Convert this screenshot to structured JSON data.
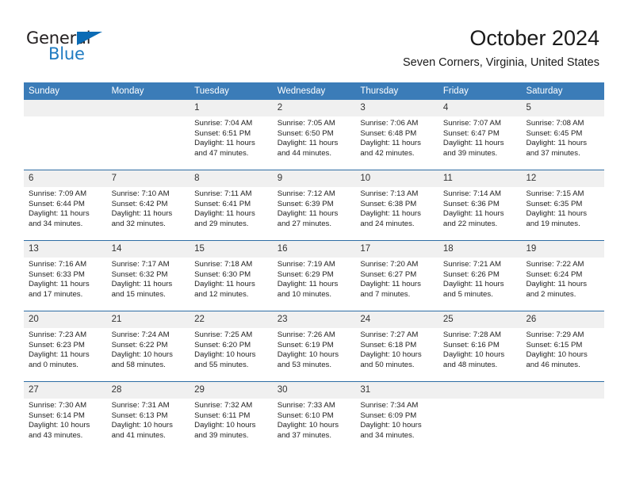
{
  "brand": {
    "name_part1": "General",
    "name_part2": "Blue",
    "accent_color": "#1f7bc1",
    "triangle_color": "#0b6bb5"
  },
  "header": {
    "title": "October 2024",
    "subtitle": "Seven Corners, Virginia, United States"
  },
  "theme": {
    "header_blue": "#3b7cb8",
    "row_separator": "#2e6da4",
    "day_band": "#f0f0f0"
  },
  "weekdays": [
    "Sunday",
    "Monday",
    "Tuesday",
    "Wednesday",
    "Thursday",
    "Friday",
    "Saturday"
  ],
  "labels": {
    "sunrise_prefix": "Sunrise:",
    "sunset_prefix": "Sunset:",
    "daylight_prefix": "Daylight:"
  },
  "weeks": [
    [
      {
        "day": "",
        "empty": true
      },
      {
        "day": "",
        "empty": true
      },
      {
        "day": "1",
        "sunrise": "Sunrise: 7:04 AM",
        "sunset": "Sunset: 6:51 PM",
        "daylight_line1": "Daylight: 11 hours",
        "daylight_line2": "and 47 minutes."
      },
      {
        "day": "2",
        "sunrise": "Sunrise: 7:05 AM",
        "sunset": "Sunset: 6:50 PM",
        "daylight_line1": "Daylight: 11 hours",
        "daylight_line2": "and 44 minutes."
      },
      {
        "day": "3",
        "sunrise": "Sunrise: 7:06 AM",
        "sunset": "Sunset: 6:48 PM",
        "daylight_line1": "Daylight: 11 hours",
        "daylight_line2": "and 42 minutes."
      },
      {
        "day": "4",
        "sunrise": "Sunrise: 7:07 AM",
        "sunset": "Sunset: 6:47 PM",
        "daylight_line1": "Daylight: 11 hours",
        "daylight_line2": "and 39 minutes."
      },
      {
        "day": "5",
        "sunrise": "Sunrise: 7:08 AM",
        "sunset": "Sunset: 6:45 PM",
        "daylight_line1": "Daylight: 11 hours",
        "daylight_line2": "and 37 minutes."
      }
    ],
    [
      {
        "day": "6",
        "sunrise": "Sunrise: 7:09 AM",
        "sunset": "Sunset: 6:44 PM",
        "daylight_line1": "Daylight: 11 hours",
        "daylight_line2": "and 34 minutes."
      },
      {
        "day": "7",
        "sunrise": "Sunrise: 7:10 AM",
        "sunset": "Sunset: 6:42 PM",
        "daylight_line1": "Daylight: 11 hours",
        "daylight_line2": "and 32 minutes."
      },
      {
        "day": "8",
        "sunrise": "Sunrise: 7:11 AM",
        "sunset": "Sunset: 6:41 PM",
        "daylight_line1": "Daylight: 11 hours",
        "daylight_line2": "and 29 minutes."
      },
      {
        "day": "9",
        "sunrise": "Sunrise: 7:12 AM",
        "sunset": "Sunset: 6:39 PM",
        "daylight_line1": "Daylight: 11 hours",
        "daylight_line2": "and 27 minutes."
      },
      {
        "day": "10",
        "sunrise": "Sunrise: 7:13 AM",
        "sunset": "Sunset: 6:38 PM",
        "daylight_line1": "Daylight: 11 hours",
        "daylight_line2": "and 24 minutes."
      },
      {
        "day": "11",
        "sunrise": "Sunrise: 7:14 AM",
        "sunset": "Sunset: 6:36 PM",
        "daylight_line1": "Daylight: 11 hours",
        "daylight_line2": "and 22 minutes."
      },
      {
        "day": "12",
        "sunrise": "Sunrise: 7:15 AM",
        "sunset": "Sunset: 6:35 PM",
        "daylight_line1": "Daylight: 11 hours",
        "daylight_line2": "and 19 minutes."
      }
    ],
    [
      {
        "day": "13",
        "sunrise": "Sunrise: 7:16 AM",
        "sunset": "Sunset: 6:33 PM",
        "daylight_line1": "Daylight: 11 hours",
        "daylight_line2": "and 17 minutes."
      },
      {
        "day": "14",
        "sunrise": "Sunrise: 7:17 AM",
        "sunset": "Sunset: 6:32 PM",
        "daylight_line1": "Daylight: 11 hours",
        "daylight_line2": "and 15 minutes."
      },
      {
        "day": "15",
        "sunrise": "Sunrise: 7:18 AM",
        "sunset": "Sunset: 6:30 PM",
        "daylight_line1": "Daylight: 11 hours",
        "daylight_line2": "and 12 minutes."
      },
      {
        "day": "16",
        "sunrise": "Sunrise: 7:19 AM",
        "sunset": "Sunset: 6:29 PM",
        "daylight_line1": "Daylight: 11 hours",
        "daylight_line2": "and 10 minutes."
      },
      {
        "day": "17",
        "sunrise": "Sunrise: 7:20 AM",
        "sunset": "Sunset: 6:27 PM",
        "daylight_line1": "Daylight: 11 hours",
        "daylight_line2": "and 7 minutes."
      },
      {
        "day": "18",
        "sunrise": "Sunrise: 7:21 AM",
        "sunset": "Sunset: 6:26 PM",
        "daylight_line1": "Daylight: 11 hours",
        "daylight_line2": "and 5 minutes."
      },
      {
        "day": "19",
        "sunrise": "Sunrise: 7:22 AM",
        "sunset": "Sunset: 6:24 PM",
        "daylight_line1": "Daylight: 11 hours",
        "daylight_line2": "and 2 minutes."
      }
    ],
    [
      {
        "day": "20",
        "sunrise": "Sunrise: 7:23 AM",
        "sunset": "Sunset: 6:23 PM",
        "daylight_line1": "Daylight: 11 hours",
        "daylight_line2": "and 0 minutes."
      },
      {
        "day": "21",
        "sunrise": "Sunrise: 7:24 AM",
        "sunset": "Sunset: 6:22 PM",
        "daylight_line1": "Daylight: 10 hours",
        "daylight_line2": "and 58 minutes."
      },
      {
        "day": "22",
        "sunrise": "Sunrise: 7:25 AM",
        "sunset": "Sunset: 6:20 PM",
        "daylight_line1": "Daylight: 10 hours",
        "daylight_line2": "and 55 minutes."
      },
      {
        "day": "23",
        "sunrise": "Sunrise: 7:26 AM",
        "sunset": "Sunset: 6:19 PM",
        "daylight_line1": "Daylight: 10 hours",
        "daylight_line2": "and 53 minutes."
      },
      {
        "day": "24",
        "sunrise": "Sunrise: 7:27 AM",
        "sunset": "Sunset: 6:18 PM",
        "daylight_line1": "Daylight: 10 hours",
        "daylight_line2": "and 50 minutes."
      },
      {
        "day": "25",
        "sunrise": "Sunrise: 7:28 AM",
        "sunset": "Sunset: 6:16 PM",
        "daylight_line1": "Daylight: 10 hours",
        "daylight_line2": "and 48 minutes."
      },
      {
        "day": "26",
        "sunrise": "Sunrise: 7:29 AM",
        "sunset": "Sunset: 6:15 PM",
        "daylight_line1": "Daylight: 10 hours",
        "daylight_line2": "and 46 minutes."
      }
    ],
    [
      {
        "day": "27",
        "sunrise": "Sunrise: 7:30 AM",
        "sunset": "Sunset: 6:14 PM",
        "daylight_line1": "Daylight: 10 hours",
        "daylight_line2": "and 43 minutes."
      },
      {
        "day": "28",
        "sunrise": "Sunrise: 7:31 AM",
        "sunset": "Sunset: 6:13 PM",
        "daylight_line1": "Daylight: 10 hours",
        "daylight_line2": "and 41 minutes."
      },
      {
        "day": "29",
        "sunrise": "Sunrise: 7:32 AM",
        "sunset": "Sunset: 6:11 PM",
        "daylight_line1": "Daylight: 10 hours",
        "daylight_line2": "and 39 minutes."
      },
      {
        "day": "30",
        "sunrise": "Sunrise: 7:33 AM",
        "sunset": "Sunset: 6:10 PM",
        "daylight_line1": "Daylight: 10 hours",
        "daylight_line2": "and 37 minutes."
      },
      {
        "day": "31",
        "sunrise": "Sunrise: 7:34 AM",
        "sunset": "Sunset: 6:09 PM",
        "daylight_line1": "Daylight: 10 hours",
        "daylight_line2": "and 34 minutes."
      },
      {
        "day": "",
        "empty": true
      },
      {
        "day": "",
        "empty": true
      }
    ]
  ]
}
